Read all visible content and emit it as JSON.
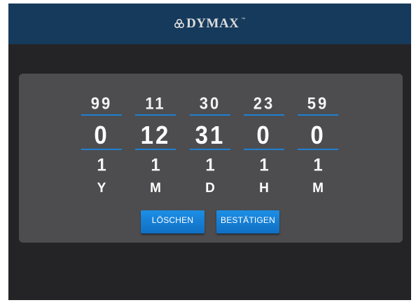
{
  "header": {
    "brand": "DYMAX",
    "brand_mark": "dymax-logo-icon"
  },
  "picker": {
    "columns": [
      {
        "max": "99",
        "value": "0",
        "min": "1",
        "unit": "Y"
      },
      {
        "max": "11",
        "value": "12",
        "min": "1",
        "unit": "M"
      },
      {
        "max": "30",
        "value": "31",
        "min": "1",
        "unit": "D"
      },
      {
        "max": "23",
        "value": "0",
        "min": "1",
        "unit": "H"
      },
      {
        "max": "59",
        "value": "0",
        "min": "1",
        "unit": "M"
      }
    ]
  },
  "buttons": {
    "clear_label": "LÖSCHEN",
    "confirm_label": "BESTÄTIGEN"
  },
  "colors": {
    "header_bg": "#163a5c",
    "screen_bg": "#242426",
    "panel_bg": "#4d4d4f",
    "accent_line": "#1f7fd1",
    "button_bg": "#1283d6"
  }
}
